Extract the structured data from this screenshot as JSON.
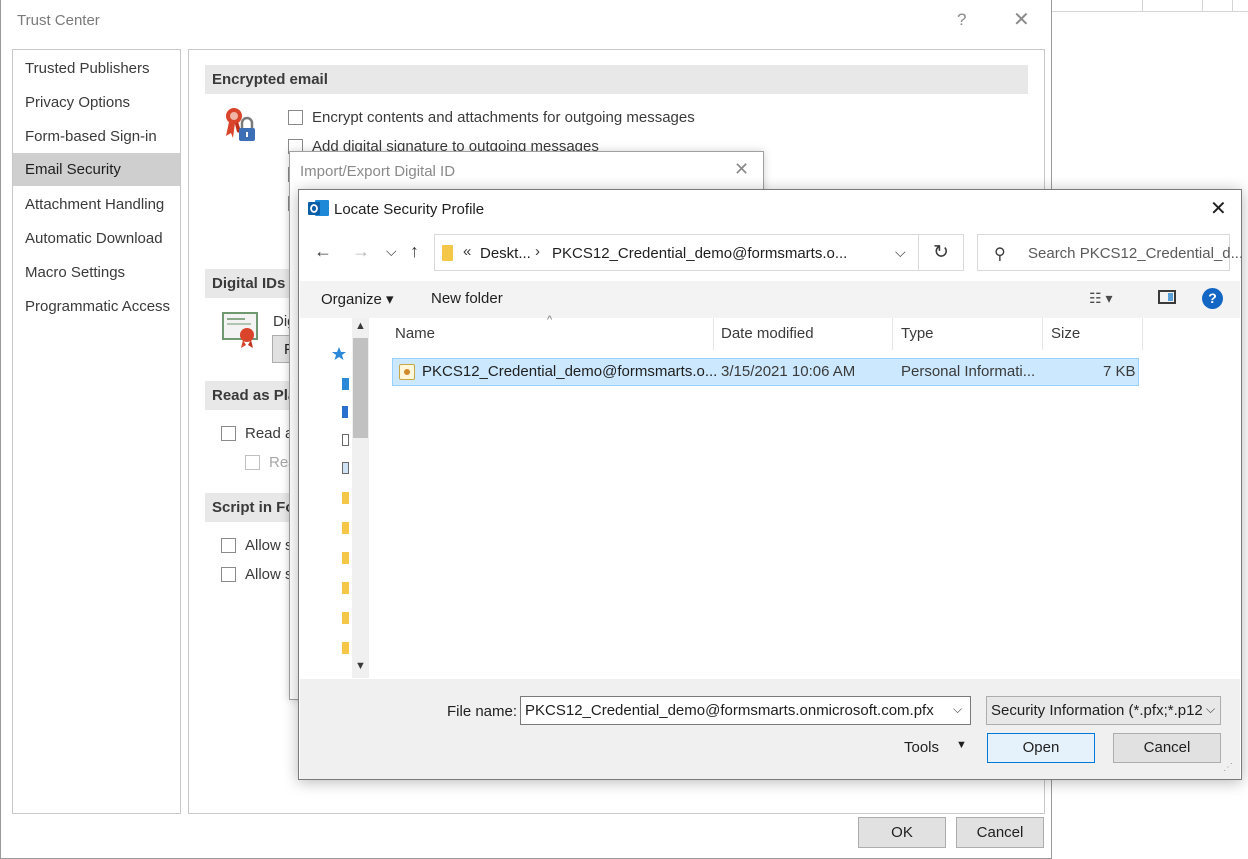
{
  "trust_center": {
    "title": "Trust Center",
    "help": "?",
    "close": "✕",
    "nav": [
      {
        "label": "Trusted Publishers",
        "selected": false
      },
      {
        "label": "Privacy Options",
        "selected": false
      },
      {
        "label": "Form-based Sign-in",
        "selected": false
      },
      {
        "label": "Email Security",
        "selected": true
      },
      {
        "label": "Attachment Handling",
        "selected": false
      },
      {
        "label": "Automatic Download",
        "selected": false
      },
      {
        "label": "Macro Settings",
        "selected": false
      },
      {
        "label": "Programmatic Access",
        "selected": false
      }
    ],
    "encrypted_email": {
      "heading": "Encrypted email",
      "encrypt_contents": "Encrypt contents and attachments for outgoing messages",
      "add_signature": "Add digital signature to outgoing messages"
    },
    "digital_ids": {
      "heading": "Digital IDs",
      "text_partial": "Dig",
      "button_partial": "P"
    },
    "read_as_plain": {
      "heading": "Read as Pla",
      "read_all": "Read a",
      "read_signed": "Rea"
    },
    "script_in_folders": {
      "heading": "Script in Fo",
      "allow_1": "Allow s",
      "allow_2": "Allow s"
    },
    "ok_label": "OK",
    "cancel_label": "Cancel"
  },
  "import_export": {
    "title": "Import/Export Digital ID",
    "close": "✕"
  },
  "locate_dialog": {
    "title": "Locate Security Profile",
    "close": "✕",
    "nav": {
      "back": "←",
      "forward": "→",
      "recent": "⌵",
      "up": "↑"
    },
    "address": {
      "overflow": "«",
      "crumb1": "Deskt...",
      "separator": "›",
      "crumb2": "PKCS12_Credential_demo@formsmarts.o...",
      "dropdown": "⌵",
      "refresh": "↻"
    },
    "search": {
      "icon": "⚲",
      "placeholder": "Search PKCS12_Credential_d..."
    },
    "toolbar": {
      "organize": "Organize ▾",
      "new_folder": "New folder",
      "views": "☷ ▾",
      "help": "?"
    },
    "columns": {
      "name": "Name",
      "date": "Date modified",
      "type": "Type",
      "size": "Size"
    },
    "files": [
      {
        "name": "PKCS12_Credential_demo@formsmarts.o...",
        "date": "3/15/2021 10:06 AM",
        "type": "Personal Informati...",
        "size": "7 KB",
        "selected": true
      }
    ],
    "file_name_label": "File name:",
    "file_name_value": "PKCS12_Credential_demo@formsmarts.onmicrosoft.com.pfx",
    "file_type_value": "Security Information (*.pfx;*.p12",
    "tools_label": "Tools",
    "open_label": "Open",
    "cancel_label": "Cancel"
  }
}
